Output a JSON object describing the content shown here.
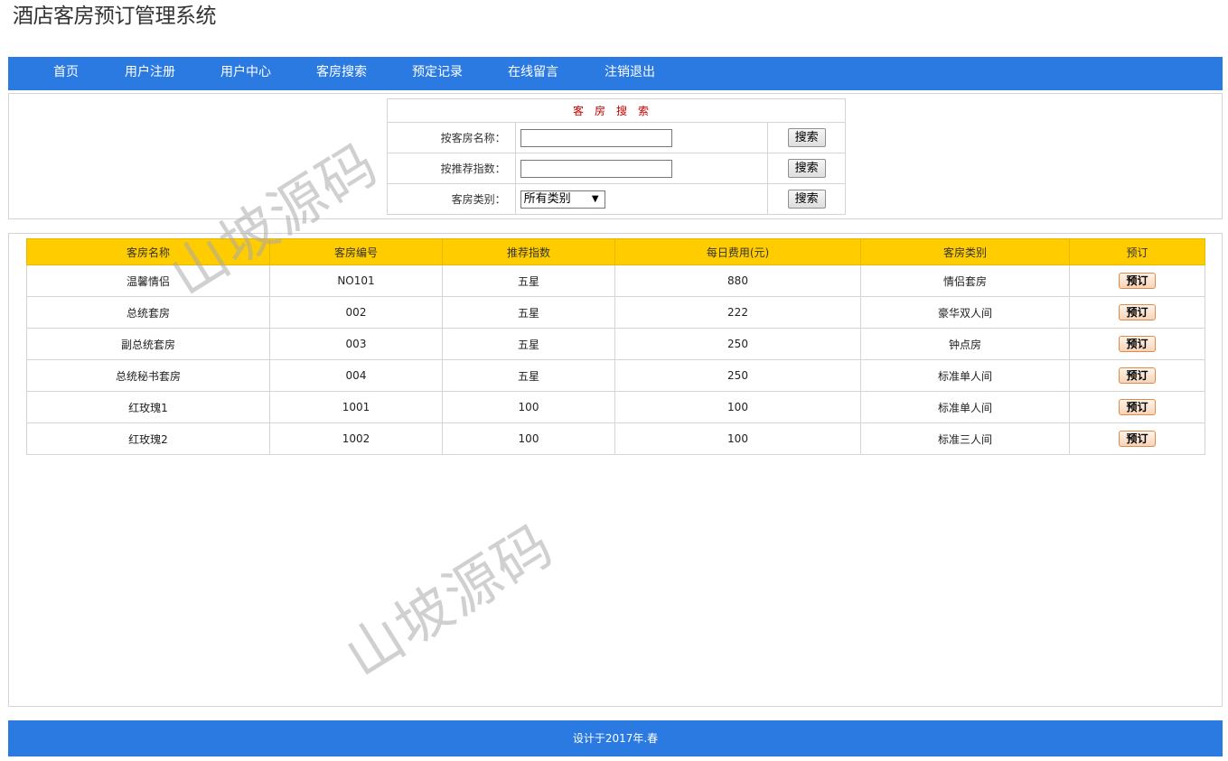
{
  "header": {
    "title": "酒店客房预订管理系统"
  },
  "nav": {
    "items": [
      {
        "label": "首页"
      },
      {
        "label": "用户注册"
      },
      {
        "label": "用户中心"
      },
      {
        "label": "客房搜索"
      },
      {
        "label": "预定记录"
      },
      {
        "label": "在线留言"
      },
      {
        "label": "注销退出"
      }
    ]
  },
  "search": {
    "caption": "客房搜索",
    "by_name_label": "按客房名称：",
    "by_rating_label": "按推荐指数：",
    "by_type_label": "客房类别：",
    "name_value": "",
    "rating_value": "",
    "type_selected": "所有类别",
    "button_label": "搜索"
  },
  "rooms": {
    "columns": [
      "客房名称",
      "客房编号",
      "推荐指数",
      "每日费用(元)",
      "客房类别",
      "预订"
    ],
    "book_label": "预订",
    "rows": [
      {
        "name": "温馨情侣",
        "code": "NO101",
        "rating": "五星",
        "price": "880",
        "type": "情侣套房"
      },
      {
        "name": "总统套房",
        "code": "002",
        "rating": "五星",
        "price": "222",
        "type": "豪华双人间"
      },
      {
        "name": "副总统套房",
        "code": "003",
        "rating": "五星",
        "price": "250",
        "type": "钟点房"
      },
      {
        "name": "总统秘书套房",
        "code": "004",
        "rating": "五星",
        "price": "250",
        "type": "标准单人间"
      },
      {
        "name": "红玫瑰1",
        "code": "1001",
        "rating": "100",
        "price": "100",
        "type": "标准单人间"
      },
      {
        "name": "红玫瑰2",
        "code": "1002",
        "rating": "100",
        "price": "100",
        "type": "标准三人间"
      }
    ]
  },
  "footer": {
    "text": "设计于2017年.春"
  },
  "watermark": {
    "text": "山坡源码"
  },
  "colors": {
    "nav_bg": "#2a7ae2",
    "header_row_bg": "#ffcc00",
    "caption_red": "#c00000"
  }
}
